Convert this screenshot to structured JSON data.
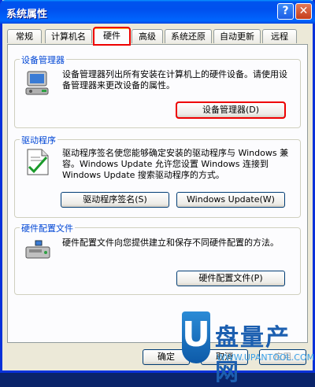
{
  "window": {
    "title": "系统属性"
  },
  "titlebar": {
    "help_glyph": "?",
    "close_glyph": "✕"
  },
  "tabs": [
    {
      "label": "常规"
    },
    {
      "label": "计算机名"
    },
    {
      "label": "硬件",
      "active": true
    },
    {
      "label": "高级"
    },
    {
      "label": "系统还原"
    },
    {
      "label": "自动更新"
    },
    {
      "label": "远程"
    }
  ],
  "device_manager": {
    "heading": "设备管理器",
    "description": "设备管理器列出所有安装在计算机上的硬件设备。请使用设备管理器来更改设备的属性。",
    "button": "设备管理器(D)",
    "icon": "device-manager-icon"
  },
  "drivers": {
    "heading": "驱动程序",
    "description": "驱动程序签名使您能够确定安装的驱动程序与 Windows 兼容。Windows Update 允许您设置 Windows 连接到 Windows Update 搜索驱动程序的方式。",
    "signing_button": "驱动程序签名(S)",
    "update_button": "Windows Update(W)",
    "icon": "driver-signing-icon"
  },
  "hardware_profiles": {
    "heading": "硬件配置文件",
    "description": "硬件配置文件向您提供建立和保存不同硬件配置的方法。",
    "button": "硬件配置文件(P)",
    "icon": "hardware-profile-icon"
  },
  "dialog_buttons": {
    "ok": "确定",
    "cancel": "取消",
    "apply": "应用"
  },
  "watermark": {
    "letter": "U",
    "text": "盘量产网",
    "sub": "WWW.UPANTOOL.COM"
  },
  "colors": {
    "highlight": "#e00000",
    "group_label": "#0046d5",
    "title_bar": "#0054e3"
  }
}
